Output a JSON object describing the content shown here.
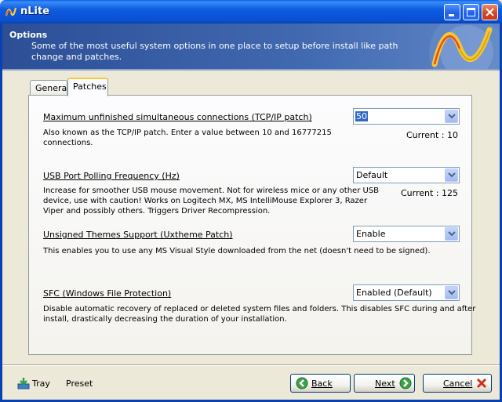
{
  "window": {
    "title": "nLite"
  },
  "header": {
    "title": "Options",
    "description": "Some of the most useful system options in one place to setup before install like path change and patches."
  },
  "tabs": [
    {
      "label": "General",
      "selected": false
    },
    {
      "label": "Patches",
      "selected": true
    }
  ],
  "options": [
    {
      "title": "Maximum unfinished simultaneous connections (TCP/IP patch)",
      "description": [
        "Also known as the TCP/IP patch. Enter a value between 10 and 16777215",
        "connections."
      ],
      "value": "50",
      "current": "Current : 10"
    },
    {
      "title": "USB Port Polling Frequency (Hz)",
      "description": [
        "Increase for smoother USB mouse movement. Not for wireless mice or any other USB",
        "device, use with caution! Works on Logitech MX, MS IntelliMouse Explorer 3, Razer",
        "Viper and possibly others. Triggers Driver Recompression."
      ],
      "value": "Default",
      "current": "Current : 125"
    },
    {
      "title": "Unsigned Themes Support (Uxtheme Patch)",
      "description": [
        "This enables you to use any MS Visual Style downloaded from the net (doesn't need to be signed)."
      ],
      "value": "Enable",
      "current": ""
    },
    {
      "title": "SFC (Windows File Protection)",
      "description": [
        "Disable automatic recovery of replaced or deleted system files and folders. This disables SFC during and after",
        "install, drastically decreasing the duration of your installation."
      ],
      "value": "Enabled (Default)",
      "current": ""
    }
  ],
  "footer": {
    "tray_label": "Tray",
    "preset_label": "Preset",
    "back_label": "Back",
    "next_label": "Next",
    "cancel_label": "Cancel"
  },
  "colors": {
    "titlebar": "#0a50d0",
    "banner": "#4169b0",
    "selection": "#316ac5"
  },
  "icons": [
    "nlite-logo-icon",
    "minimize-icon",
    "maximize-icon",
    "close-icon",
    "tray-icon",
    "back-arrow-icon",
    "next-arrow-icon",
    "cancel-x-icon"
  ]
}
